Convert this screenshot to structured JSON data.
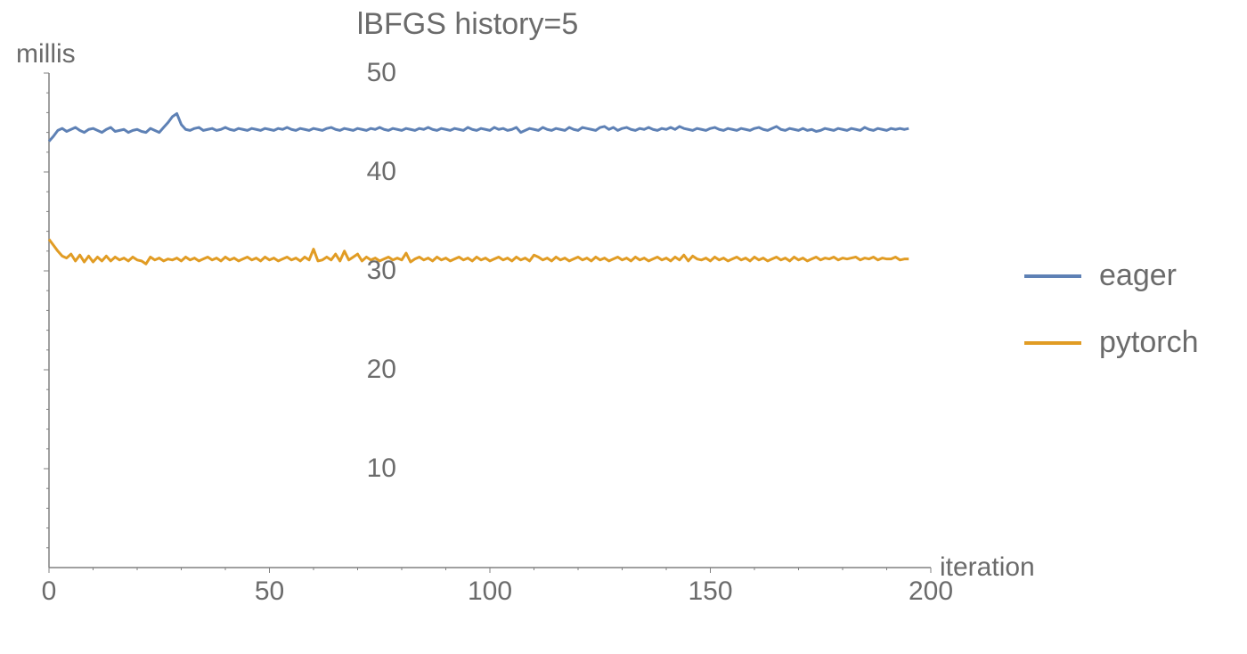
{
  "chart_data": {
    "type": "line",
    "title": "lBFGS history=5",
    "xlabel": "iteration",
    "ylabel": "millis",
    "xlim": [
      0,
      200
    ],
    "ylim": [
      0,
      50
    ],
    "xticks": [
      0,
      50,
      100,
      150,
      200
    ],
    "yticks": [
      10,
      20,
      30,
      40,
      50
    ],
    "legend_position": "right",
    "series": [
      {
        "name": "eager",
        "color": "#5e81b5",
        "x": [
          0,
          1,
          2,
          3,
          4,
          5,
          6,
          7,
          8,
          9,
          10,
          11,
          12,
          13,
          14,
          15,
          16,
          17,
          18,
          19,
          20,
          21,
          22,
          23,
          24,
          25,
          26,
          27,
          28,
          29,
          30,
          31,
          32,
          33,
          34,
          35,
          36,
          37,
          38,
          39,
          40,
          41,
          42,
          43,
          44,
          45,
          46,
          47,
          48,
          49,
          50,
          51,
          52,
          53,
          54,
          55,
          56,
          57,
          58,
          59,
          60,
          61,
          62,
          63,
          64,
          65,
          66,
          67,
          68,
          69,
          70,
          71,
          72,
          73,
          74,
          75,
          76,
          77,
          78,
          79,
          80,
          81,
          82,
          83,
          84,
          85,
          86,
          87,
          88,
          89,
          90,
          91,
          92,
          93,
          94,
          95,
          96,
          97,
          98,
          99,
          100,
          101,
          102,
          103,
          104,
          105,
          106,
          107,
          108,
          109,
          110,
          111,
          112,
          113,
          114,
          115,
          116,
          117,
          118,
          119,
          120,
          121,
          122,
          123,
          124,
          125,
          126,
          127,
          128,
          129,
          130,
          131,
          132,
          133,
          134,
          135,
          136,
          137,
          138,
          139,
          140,
          141,
          142,
          143,
          144,
          145,
          146,
          147,
          148,
          149,
          150,
          151,
          152,
          153,
          154,
          155,
          156,
          157,
          158,
          159,
          160,
          161,
          162,
          163,
          164,
          165,
          166,
          167,
          168,
          169,
          170,
          171,
          172,
          173,
          174,
          175,
          176,
          177,
          178,
          179,
          180,
          181,
          182,
          183,
          184,
          185,
          186,
          187,
          188,
          189,
          190,
          191,
          192,
          193,
          194,
          195
        ],
        "values": [
          43.1,
          43.6,
          44.2,
          44.4,
          44.1,
          44.3,
          44.5,
          44.2,
          44.0,
          44.3,
          44.4,
          44.2,
          44.0,
          44.3,
          44.5,
          44.1,
          44.2,
          44.3,
          44.0,
          44.2,
          44.3,
          44.1,
          44.0,
          44.4,
          44.2,
          44.0,
          44.5,
          45.0,
          45.6,
          45.9,
          44.8,
          44.3,
          44.2,
          44.4,
          44.5,
          44.2,
          44.3,
          44.4,
          44.2,
          44.3,
          44.5,
          44.3,
          44.2,
          44.4,
          44.3,
          44.2,
          44.4,
          44.3,
          44.2,
          44.4,
          44.3,
          44.2,
          44.4,
          44.3,
          44.5,
          44.3,
          44.2,
          44.4,
          44.3,
          44.2,
          44.4,
          44.3,
          44.2,
          44.4,
          44.5,
          44.3,
          44.2,
          44.4,
          44.3,
          44.2,
          44.4,
          44.3,
          44.2,
          44.4,
          44.3,
          44.5,
          44.3,
          44.2,
          44.4,
          44.3,
          44.2,
          44.4,
          44.3,
          44.2,
          44.4,
          44.3,
          44.5,
          44.3,
          44.2,
          44.4,
          44.3,
          44.2,
          44.4,
          44.3,
          44.2,
          44.5,
          44.3,
          44.2,
          44.4,
          44.3,
          44.2,
          44.5,
          44.3,
          44.4,
          44.2,
          44.3,
          44.5,
          44.0,
          44.2,
          44.4,
          44.3,
          44.2,
          44.5,
          44.3,
          44.2,
          44.4,
          44.3,
          44.2,
          44.5,
          44.3,
          44.2,
          44.5,
          44.4,
          44.3,
          44.2,
          44.5,
          44.6,
          44.3,
          44.5,
          44.2,
          44.4,
          44.5,
          44.3,
          44.2,
          44.4,
          44.3,
          44.5,
          44.3,
          44.2,
          44.4,
          44.3,
          44.5,
          44.3,
          44.6,
          44.4,
          44.3,
          44.2,
          44.4,
          44.3,
          44.2,
          44.4,
          44.5,
          44.3,
          44.2,
          44.4,
          44.3,
          44.2,
          44.4,
          44.3,
          44.2,
          44.4,
          44.5,
          44.3,
          44.2,
          44.4,
          44.6,
          44.3,
          44.2,
          44.4,
          44.3,
          44.2,
          44.4,
          44.2,
          44.3,
          44.1,
          44.2,
          44.4,
          44.3,
          44.2,
          44.4,
          44.3,
          44.2,
          44.4,
          44.3,
          44.2,
          44.5,
          44.3,
          44.2,
          44.4,
          44.3,
          44.2,
          44.4,
          44.3,
          44.4,
          44.3,
          44.4
        ]
      },
      {
        "name": "pytorch",
        "color": "#e19c24",
        "x": [
          0,
          1,
          2,
          3,
          4,
          5,
          6,
          7,
          8,
          9,
          10,
          11,
          12,
          13,
          14,
          15,
          16,
          17,
          18,
          19,
          20,
          21,
          22,
          23,
          24,
          25,
          26,
          27,
          28,
          29,
          30,
          31,
          32,
          33,
          34,
          35,
          36,
          37,
          38,
          39,
          40,
          41,
          42,
          43,
          44,
          45,
          46,
          47,
          48,
          49,
          50,
          51,
          52,
          53,
          54,
          55,
          56,
          57,
          58,
          59,
          60,
          61,
          62,
          63,
          64,
          65,
          66,
          67,
          68,
          69,
          70,
          71,
          72,
          73,
          74,
          75,
          76,
          77,
          78,
          79,
          80,
          81,
          82,
          83,
          84,
          85,
          86,
          87,
          88,
          89,
          90,
          91,
          92,
          93,
          94,
          95,
          96,
          97,
          98,
          99,
          100,
          101,
          102,
          103,
          104,
          105,
          106,
          107,
          108,
          109,
          110,
          111,
          112,
          113,
          114,
          115,
          116,
          117,
          118,
          119,
          120,
          121,
          122,
          123,
          124,
          125,
          126,
          127,
          128,
          129,
          130,
          131,
          132,
          133,
          134,
          135,
          136,
          137,
          138,
          139,
          140,
          141,
          142,
          143,
          144,
          145,
          146,
          147,
          148,
          149,
          150,
          151,
          152,
          153,
          154,
          155,
          156,
          157,
          158,
          159,
          160,
          161,
          162,
          163,
          164,
          165,
          166,
          167,
          168,
          169,
          170,
          171,
          172,
          173,
          174,
          175,
          176,
          177,
          178,
          179,
          180,
          181,
          182,
          183,
          184,
          185,
          186,
          187,
          188,
          189,
          190,
          191,
          192,
          193,
          194,
          195
        ],
        "values": [
          33.2,
          32.6,
          32.0,
          31.5,
          31.3,
          31.7,
          31.0,
          31.6,
          30.9,
          31.5,
          30.9,
          31.4,
          31.0,
          31.5,
          31.0,
          31.4,
          31.1,
          31.3,
          31.0,
          31.4,
          31.1,
          31.0,
          30.7,
          31.4,
          31.1,
          31.3,
          31.0,
          31.2,
          31.1,
          31.3,
          31.0,
          31.4,
          31.1,
          31.3,
          31.0,
          31.2,
          31.4,
          31.1,
          31.3,
          31.0,
          31.4,
          31.1,
          31.3,
          31.0,
          31.2,
          31.4,
          31.1,
          31.3,
          31.0,
          31.4,
          31.1,
          31.3,
          31.0,
          31.2,
          31.4,
          31.1,
          31.3,
          31.0,
          31.4,
          31.1,
          32.2,
          31.0,
          31.1,
          31.4,
          31.1,
          31.7,
          31.0,
          32.0,
          31.1,
          31.4,
          31.7,
          31.0,
          31.4,
          31.1,
          31.3,
          31.0,
          31.2,
          31.4,
          31.1,
          31.3,
          31.1,
          31.8,
          30.9,
          31.2,
          31.4,
          31.1,
          31.3,
          31.0,
          31.4,
          31.1,
          31.3,
          31.0,
          31.2,
          31.4,
          31.1,
          31.3,
          31.0,
          31.4,
          31.1,
          31.3,
          31.0,
          31.2,
          31.4,
          31.1,
          31.3,
          31.0,
          31.4,
          31.1,
          31.3,
          31.0,
          31.6,
          31.4,
          31.1,
          31.3,
          31.0,
          31.4,
          31.1,
          31.3,
          31.0,
          31.2,
          31.4,
          31.1,
          31.3,
          31.0,
          31.4,
          31.1,
          31.3,
          31.0,
          31.2,
          31.4,
          31.1,
          31.3,
          31.0,
          31.4,
          31.1,
          31.3,
          31.0,
          31.2,
          31.4,
          31.1,
          31.3,
          31.0,
          31.4,
          31.1,
          31.6,
          31.0,
          31.5,
          31.2,
          31.1,
          31.3,
          31.0,
          31.4,
          31.1,
          31.3,
          31.0,
          31.2,
          31.4,
          31.1,
          31.3,
          31.0,
          31.4,
          31.1,
          31.3,
          31.0,
          31.2,
          31.4,
          31.1,
          31.3,
          31.0,
          31.4,
          31.1,
          31.3,
          31.0,
          31.2,
          31.4,
          31.1,
          31.3,
          31.2,
          31.4,
          31.1,
          31.3,
          31.2,
          31.3,
          31.4,
          31.1,
          31.3,
          31.2,
          31.4,
          31.1,
          31.3,
          31.2,
          31.2,
          31.4,
          31.1,
          31.2,
          31.2
        ]
      }
    ]
  }
}
